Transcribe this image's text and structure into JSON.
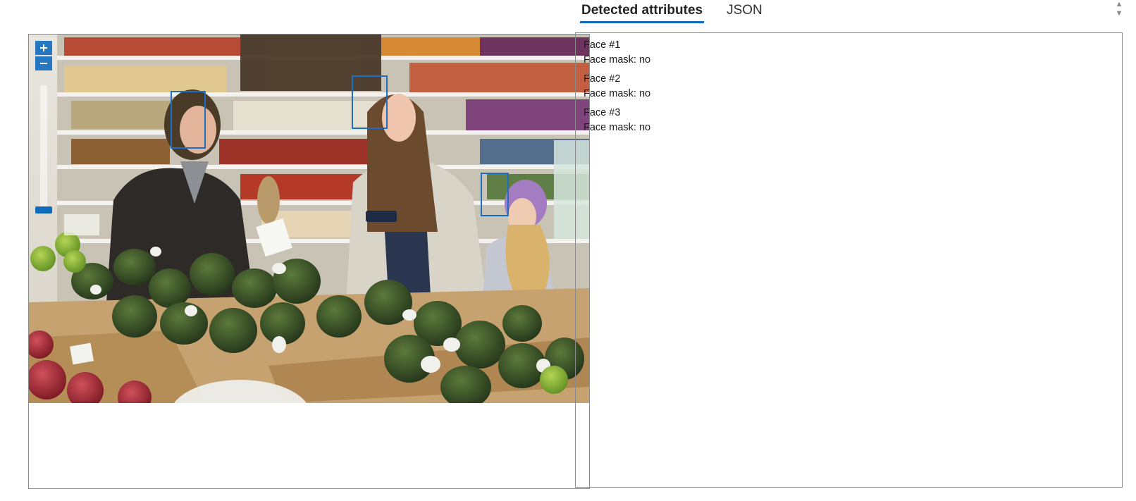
{
  "tabs": [
    {
      "label": "Detected attributes",
      "active": true
    },
    {
      "label": "JSON",
      "active": false
    }
  ],
  "viewer": {
    "image_alt": "Photo of three people smiling in a grocery store produce aisle",
    "controls": {
      "zoom_in_icon": "plus-icon",
      "zoom_out_icon": "minus-icon"
    }
  },
  "faces": [
    {
      "title": "Face #1",
      "attribute": "Face mask: no"
    },
    {
      "title": "Face #2",
      "attribute": "Face mask: no"
    },
    {
      "title": "Face #3",
      "attribute": "Face mask: no"
    }
  ],
  "colors": {
    "accent": "#0f6cbd",
    "face_box": "#1a6fc4",
    "border": "#8a8a8a"
  }
}
